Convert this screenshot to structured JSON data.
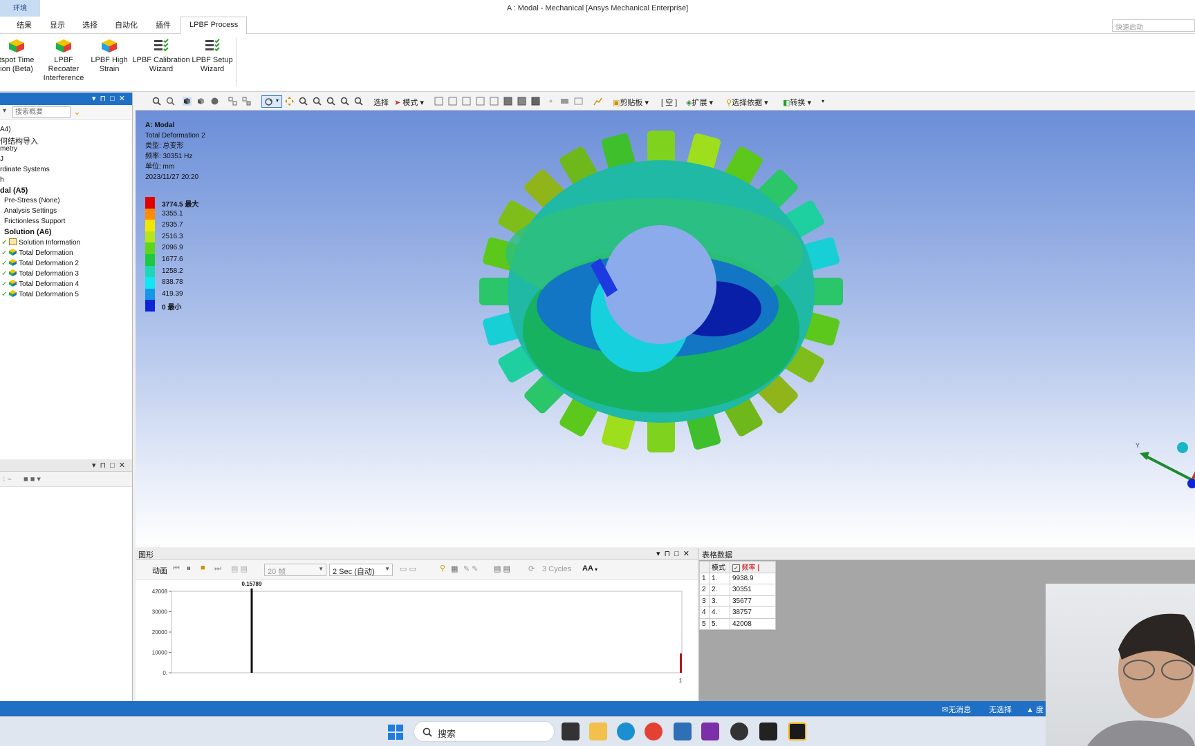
{
  "titlebar": {
    "context_tab": "环境",
    "title": "A : Modal - Mechanical [Ansys Mechanical Enterprise]"
  },
  "ribbon_tabs": [
    "结果",
    "显示",
    "选择",
    "自动化",
    "插件",
    "LPBF Process"
  ],
  "quick_launch": {
    "placeholder": "快速启动"
  },
  "ribbon": {
    "buttons": [
      {
        "line1": "tspot Time",
        "line2": "ion (Beta)"
      },
      {
        "line1": "LPBF Recoater",
        "line2": "Interference"
      },
      {
        "line1": "LPBF High",
        "line2": "Strain"
      },
      {
        "line1": "LPBF Calibration",
        "line2": "Wizard"
      },
      {
        "line1": "LPBF Setup",
        "line2": "Wizard"
      }
    ]
  },
  "outline": {
    "search_placeholder": "搜索概要",
    "items": [
      {
        "text": "A4)"
      },
      {
        "text": "何结构导入"
      },
      {
        "text": "metry"
      },
      {
        "text": "J"
      },
      {
        "text": "rdinate Systems"
      },
      {
        "text": "h"
      },
      {
        "text": "dal (A5)"
      },
      {
        "text": "Pre-Stress (None)"
      },
      {
        "text": "Analysis Settings"
      },
      {
        "text": "Frictionless Support"
      },
      {
        "text": "Solution (A6)"
      },
      {
        "text": "Solution Information"
      },
      {
        "text": "Total Deformation"
      },
      {
        "text": "Total Deformation 2"
      },
      {
        "text": "Total Deformation 3"
      },
      {
        "text": "Total Deformation 4"
      },
      {
        "text": "Total Deformation 5"
      }
    ]
  },
  "viewport_toolbar": {
    "select": "选择",
    "mode": "模式",
    "clipboard": "剪贴板",
    "empty": "[ 空 ]",
    "extend": "扩展",
    "select_by": "选择依据",
    "convert": "转换"
  },
  "viewport": {
    "model": "A: Modal",
    "result": "Total Deformation 2",
    "type": "类型: 总变形",
    "freq": "频率: 30351   Hz",
    "unit": "单位: mm",
    "date": "2023/11/27 20:20",
    "legend": [
      {
        "label": "3774.5 最大",
        "color": "#e00000"
      },
      {
        "label": "3355.1",
        "color": "#ff8c00"
      },
      {
        "label": "2935.7",
        "color": "#f2e600"
      },
      {
        "label": "2516.3",
        "color": "#b5e61d"
      },
      {
        "label": "2096.9",
        "color": "#5cd61b"
      },
      {
        "label": "1677.6",
        "color": "#1ec840"
      },
      {
        "label": "1258.2",
        "color": "#1fd6b5"
      },
      {
        "label": "838.78",
        "color": "#11e6f2"
      },
      {
        "label": "419.39",
        "color": "#1596e8"
      },
      {
        "label": "0 最小",
        "color": "#0c24d6"
      }
    ],
    "triad_label": "Y"
  },
  "graph": {
    "title": "图形",
    "animate": "动画",
    "frames": "20 帧",
    "time": "2 Sec (自动)",
    "cycles": "3 Cycles",
    "aa": "AA",
    "chart_data": {
      "type": "bar",
      "x": [
        1
      ],
      "marker_label": "0.15789",
      "yticks": [
        "42008",
        "30000",
        "20000",
        "10000",
        "0."
      ],
      "xtick": "1",
      "ylim": [
        0,
        42008
      ]
    }
  },
  "table": {
    "title": "表格数据",
    "headers": [
      "模式",
      "频率 ["
    ],
    "rows": [
      {
        "idx": "1",
        "mode": "1.",
        "freq": "9938.9"
      },
      {
        "idx": "2",
        "mode": "2.",
        "freq": "30351"
      },
      {
        "idx": "3",
        "mode": "3.",
        "freq": "35677"
      },
      {
        "idx": "4",
        "mode": "4.",
        "freq": "38757"
      },
      {
        "idx": "5",
        "mode": "5.",
        "freq": "42008"
      }
    ]
  },
  "status": {
    "messages": "无消息",
    "selection": "无选择",
    "units": "度"
  },
  "taskbar": {
    "search": "搜索"
  }
}
